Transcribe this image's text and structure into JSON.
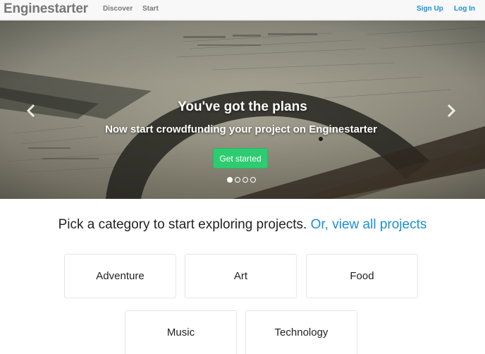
{
  "navbar": {
    "brand": "Enginestarter",
    "links": [
      "Discover",
      "Start"
    ],
    "signup_label": "Sign Up",
    "login_label": "Log In"
  },
  "hero": {
    "title": "You've got the plans",
    "subtitle": "Now start crowdfunding your project on Enginestarter",
    "cta_label": "Get started",
    "slide_count": 4,
    "active_slide": 1,
    "prev_icon": "chevron-left-icon",
    "next_icon": "chevron-right-icon"
  },
  "categories": {
    "heading_text": "Pick a category to start exploring projects.",
    "view_all_link": "Or, view all projects",
    "items": [
      "Adventure",
      "Art",
      "Food",
      "Music",
      "Technology"
    ]
  },
  "colors": {
    "link_blue": "#1a8fd6",
    "cta_green": "#2ecc71",
    "navbar_bg": "#f8f8f8"
  }
}
